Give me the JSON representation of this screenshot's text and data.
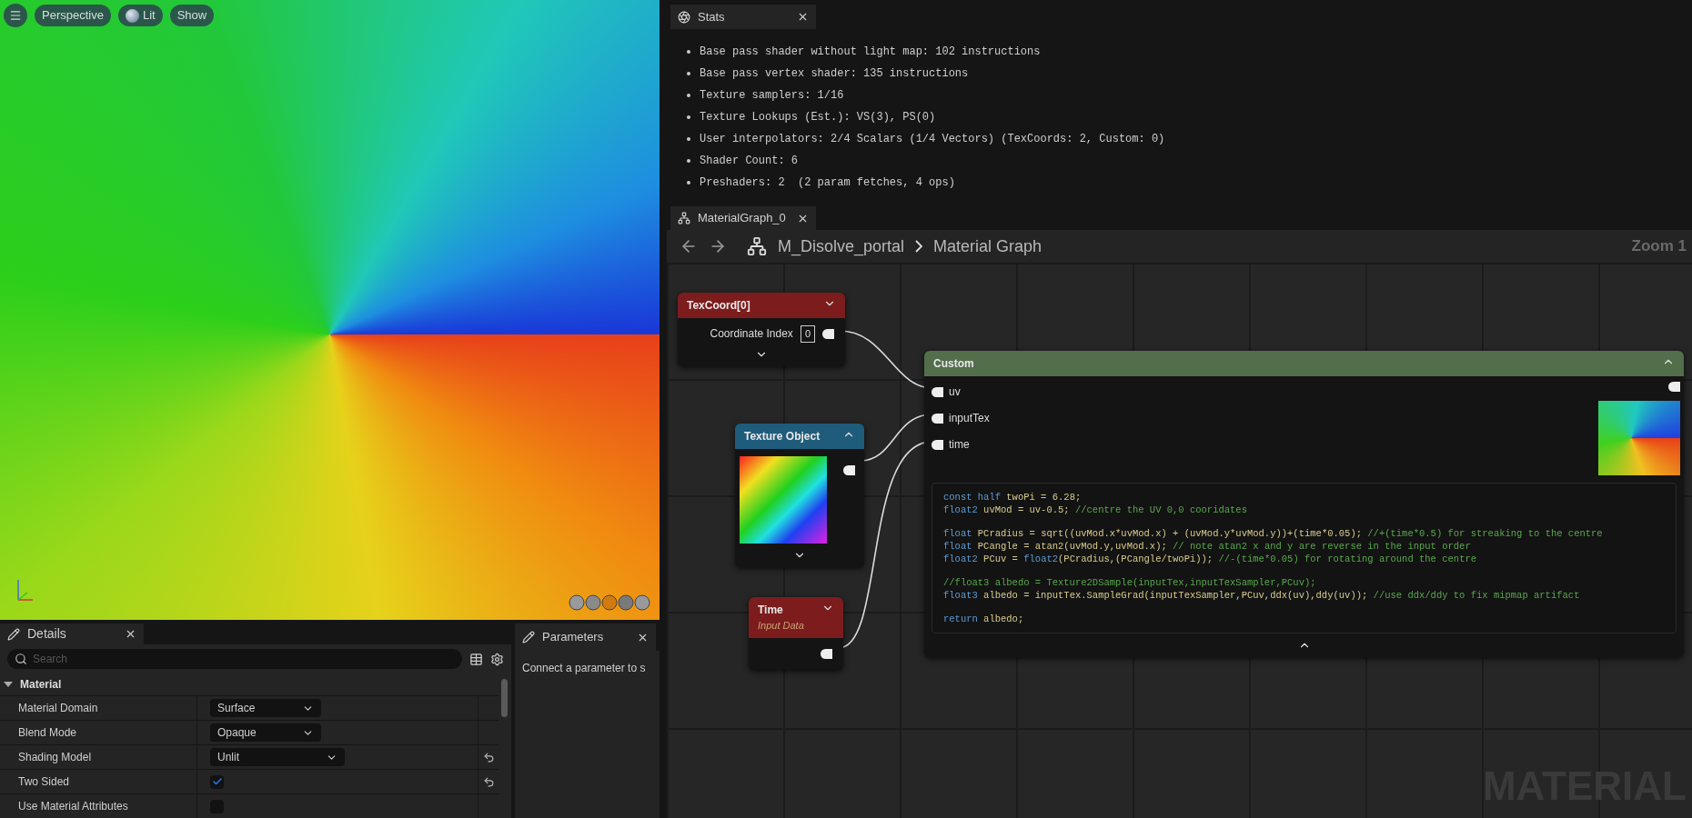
{
  "viewport": {
    "toolbar": [
      {
        "kind": "text",
        "label": "Perspective"
      },
      {
        "kind": "lit",
        "label": "Lit"
      },
      {
        "kind": "text",
        "label": "Show"
      }
    ]
  },
  "details": {
    "tab": "Details",
    "search": {
      "placeholder": "Search"
    },
    "section": {
      "title": "Material",
      "expanded": true
    },
    "rows": [
      {
        "label": "Material Domain",
        "kind": "dropdown",
        "value": "Surface",
        "resettable": false
      },
      {
        "label": "Blend Mode",
        "kind": "dropdown",
        "value": "Opaque",
        "resettable": false
      },
      {
        "label": "Shading Model",
        "kind": "dropdown",
        "value": "Unlit",
        "resettable": true
      },
      {
        "label": "Two Sided",
        "kind": "checkbox",
        "checked": true,
        "resettable": true
      },
      {
        "label": "Use Material Attributes",
        "kind": "checkbox",
        "checked": false,
        "resettable": false
      }
    ]
  },
  "parameters": {
    "tab": "Parameters",
    "message": "Connect a parameter to s"
  },
  "stats": {
    "tab": "Stats",
    "lines": [
      "Base pass shader without light map: 102 instructions",
      "Base pass vertex shader: 135 instructions",
      "Texture samplers: 1/16",
      "Texture Lookups (Est.): VS(3), PS(0)",
      "User interpolators: 2/4 Scalars (1/4 Vectors) (TexCoords: 2, Custom: 0)",
      "Shader Count: 6",
      "Preshaders: 2  (2 param fetches, 4 ops)"
    ]
  },
  "graph": {
    "tab": "MaterialGraph_0",
    "breadcrumb": [
      "M_Disolve_portal",
      "Material Graph"
    ],
    "zoom": "Zoom 1",
    "watermark": "MATERIAL",
    "nodes": [
      {
        "kind": "texcoord",
        "title": "TexCoord[0]",
        "color": "#7c1c1c",
        "pin": "Coordinate Index",
        "value": "0"
      },
      {
        "kind": "texture",
        "title": "Texture Object",
        "color": "#1f5c7c"
      },
      {
        "kind": "time",
        "title": "Time",
        "subtitle": "Input Data",
        "color": "#7c1c1c"
      },
      {
        "kind": "custom",
        "title": "Custom",
        "color": "#536e4b",
        "inputs": [
          "uv",
          "inputTex",
          "time"
        ],
        "code_blocks": [
          [
            [
              {
                "kind": "keyword",
                "text": "const half"
              },
              {
                "kind": "text",
                "text": " twoPi = 6.28;"
              }
            ],
            [
              {
                "kind": "keyword",
                "text": "float2"
              },
              {
                "kind": "text",
                "text": " uvMod = uv-0.5; "
              },
              {
                "kind": "comment",
                "text": "//centre the UV 0,0 cooridates"
              }
            ]
          ],
          [
            [
              {
                "kind": "keyword",
                "text": "float"
              },
              {
                "kind": "text",
                "text": " PCradius = sqrt((uvMod.x*uvMod.x) + (uvMod.y*uvMod.y))+(time*0.05); "
              },
              {
                "kind": "comment",
                "text": "//+(time*0.5) for streaking to the centre"
              }
            ],
            [
              {
                "kind": "keyword",
                "text": "float"
              },
              {
                "kind": "text",
                "text": " PCangle = atan2(uvMod.y,uvMod.x); "
              },
              {
                "kind": "comment",
                "text": "// note atan2 x and y are reverse in the input order"
              }
            ],
            [
              {
                "kind": "keyword",
                "text": "float2"
              },
              {
                "kind": "text",
                "text": " PCuv = "
              },
              {
                "kind": "keyword",
                "text": "float2"
              },
              {
                "kind": "text",
                "text": "(PCradius,(PCangle/twoPi)); "
              },
              {
                "kind": "comment",
                "text": "//-(time*0.05) for rotating around the centre"
              }
            ]
          ],
          [
            [
              {
                "kind": "comment",
                "text": "//float3 albedo = Texture2DSample(inputTex,inputTexSampler,PCuv);"
              }
            ],
            [
              {
                "kind": "keyword",
                "text": "float3"
              },
              {
                "kind": "text",
                "text": " albedo = inputTex.SampleGrad(inputTexSampler,PCuv,ddx(uv),ddy(uv)); "
              },
              {
                "kind": "comment",
                "text": "//use ddx/ddy to fix mipmap artifact"
              }
            ]
          ],
          [
            [
              {
                "kind": "keyword",
                "text": "return"
              },
              {
                "kind": "text",
                "text": " albedo;"
              }
            ]
          ]
        ]
      }
    ]
  }
}
